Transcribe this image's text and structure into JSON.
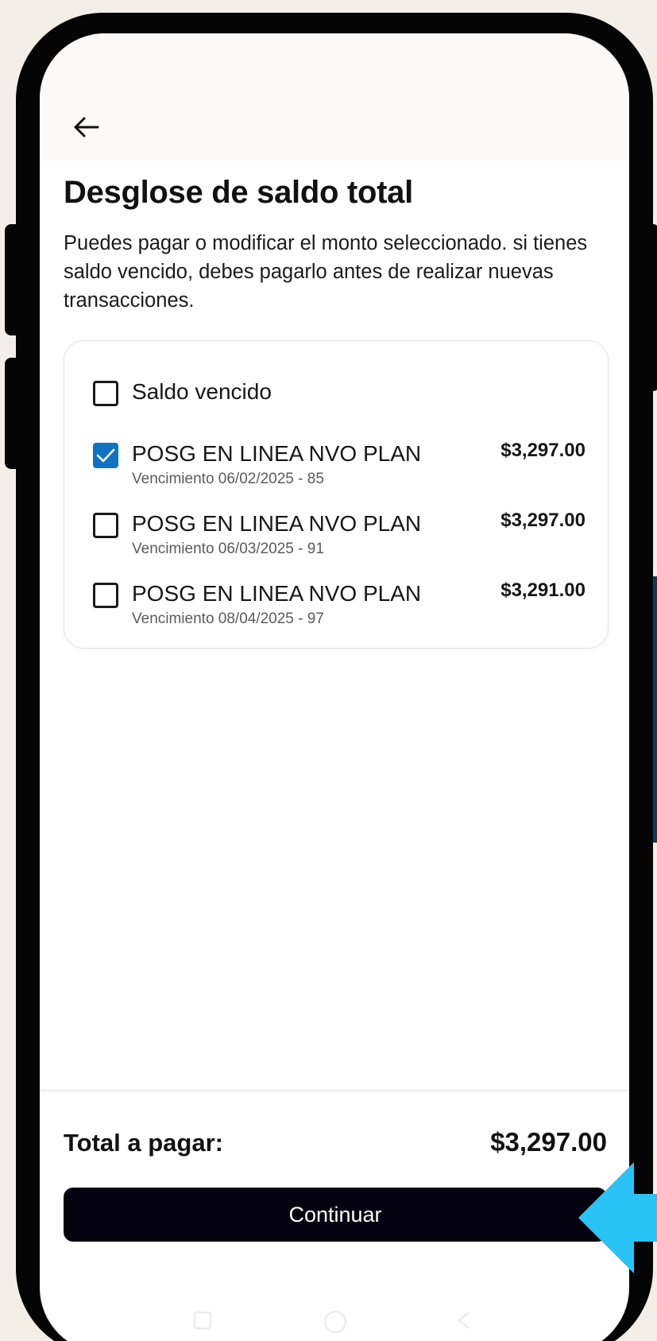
{
  "header": {
    "back_icon": "arrow-left-icon",
    "title": "Desglose de saldo total",
    "description": "Puedes pagar o modificar el monto seleccionado. si tienes saldo vencido, debes pagarlo antes de realizar nuevas transacciones."
  },
  "items": [
    {
      "label": "Saldo vencido",
      "checked": false
    },
    {
      "label": "POSG EN LINEA NVO PLAN",
      "sub": "Vencimiento 06/02/2025 - 85",
      "amount": "$3,297.00",
      "checked": true
    },
    {
      "label": "POSG EN LINEA NVO PLAN",
      "sub": "Vencimiento 06/03/2025 - 91",
      "amount": "$3,297.00",
      "checked": false
    },
    {
      "label": "POSG EN LINEA NVO PLAN",
      "sub": "Vencimiento 08/04/2025 - 97",
      "amount": "$3,291.00",
      "checked": false
    }
  ],
  "footer": {
    "total_label": "Total a pagar:",
    "total_value": "$3,297.00",
    "continue_label": "Continuar"
  },
  "nav": {
    "icons": [
      "recent-apps-icon",
      "home-icon",
      "back-nav-icon"
    ]
  },
  "colors": {
    "checkbox_checked": "#0f73c4",
    "button_bg": "#04030f",
    "pointer_arrow": "#29c4f5"
  }
}
